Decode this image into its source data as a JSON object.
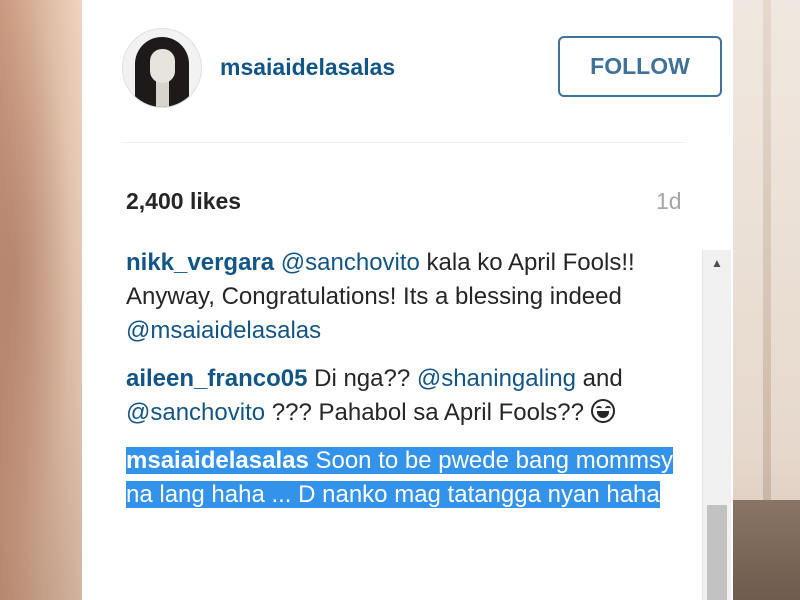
{
  "post": {
    "username": "msaiaidelasalas",
    "follow_label": "FOLLOW",
    "likes": "2,400 likes",
    "time": "1d"
  },
  "comments": [
    {
      "author": "nikk_vergara",
      "parts": [
        {
          "type": "mention",
          "text": "@sanchovito"
        },
        {
          "type": "text",
          "text": " kala ko April Fools!! Anyway, Congratulations! Its a blessing indeed "
        },
        {
          "type": "mention",
          "text": "@msaiaidelasalas"
        }
      ]
    },
    {
      "author": "aileen_franco05",
      "parts": [
        {
          "type": "text",
          "text": " Di nga?? "
        },
        {
          "type": "mention",
          "text": "@shaningaling"
        },
        {
          "type": "text",
          "text": " and "
        },
        {
          "type": "mention",
          "text": "@sanchovito"
        },
        {
          "type": "text",
          "text": " ??? Pahabol sa April Fools?? "
        }
      ],
      "emoji": "grinning-face-emoji"
    },
    {
      "author": "msaiaidelasalas",
      "text": " Soon to be pwede bang mommsy na lang haha ... D nanko mag tatangga nyan haha",
      "selected": true
    }
  ],
  "colors": {
    "link": "#125688",
    "follow_border": "#3f729b",
    "selection": "#3393ea",
    "muted": "#a5a7aa"
  },
  "icons": {
    "scroll_up": "scroll-up-arrow-icon"
  }
}
